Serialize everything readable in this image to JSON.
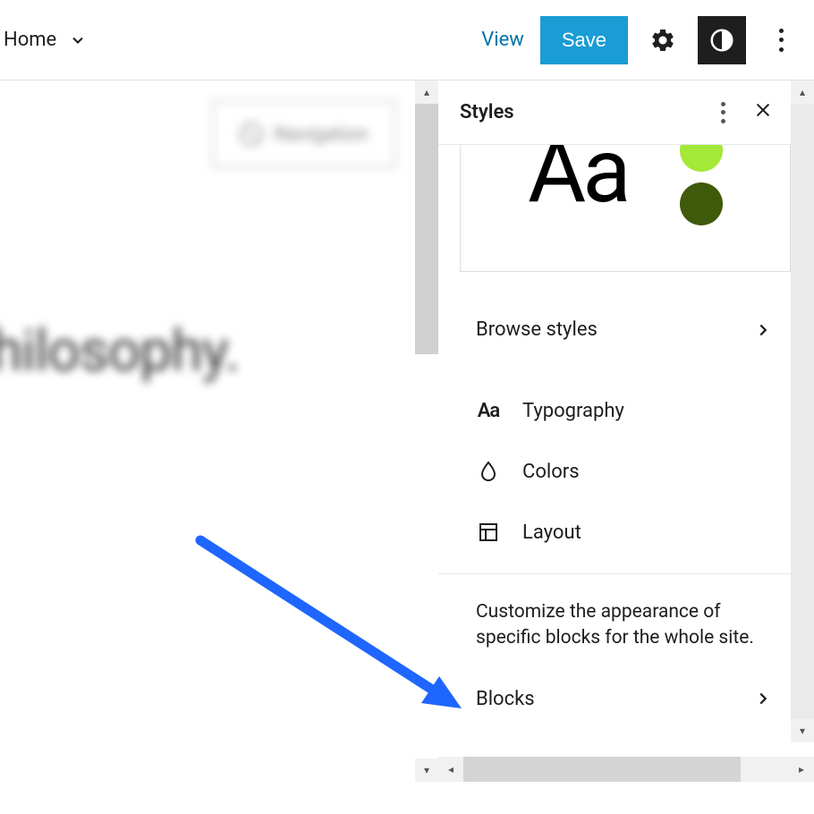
{
  "toolbar": {
    "home_label": "Home",
    "view_label": "View",
    "save_label": "Save"
  },
  "canvas": {
    "navigation_label": "Navigation",
    "heading_text": "hilosophy."
  },
  "panel": {
    "title": "Styles",
    "preview_sample": "Aa",
    "browse_label": "Browse styles",
    "typography_label": "Typography",
    "typography_icon_text": "Aa",
    "colors_label": "Colors",
    "layout_label": "Layout",
    "blocks_description": "Customize the appearance of specific blocks for the whole site.",
    "blocks_label": "Blocks",
    "swatches": {
      "lime": "#a4e838",
      "olive": "#3e5a0a"
    }
  }
}
